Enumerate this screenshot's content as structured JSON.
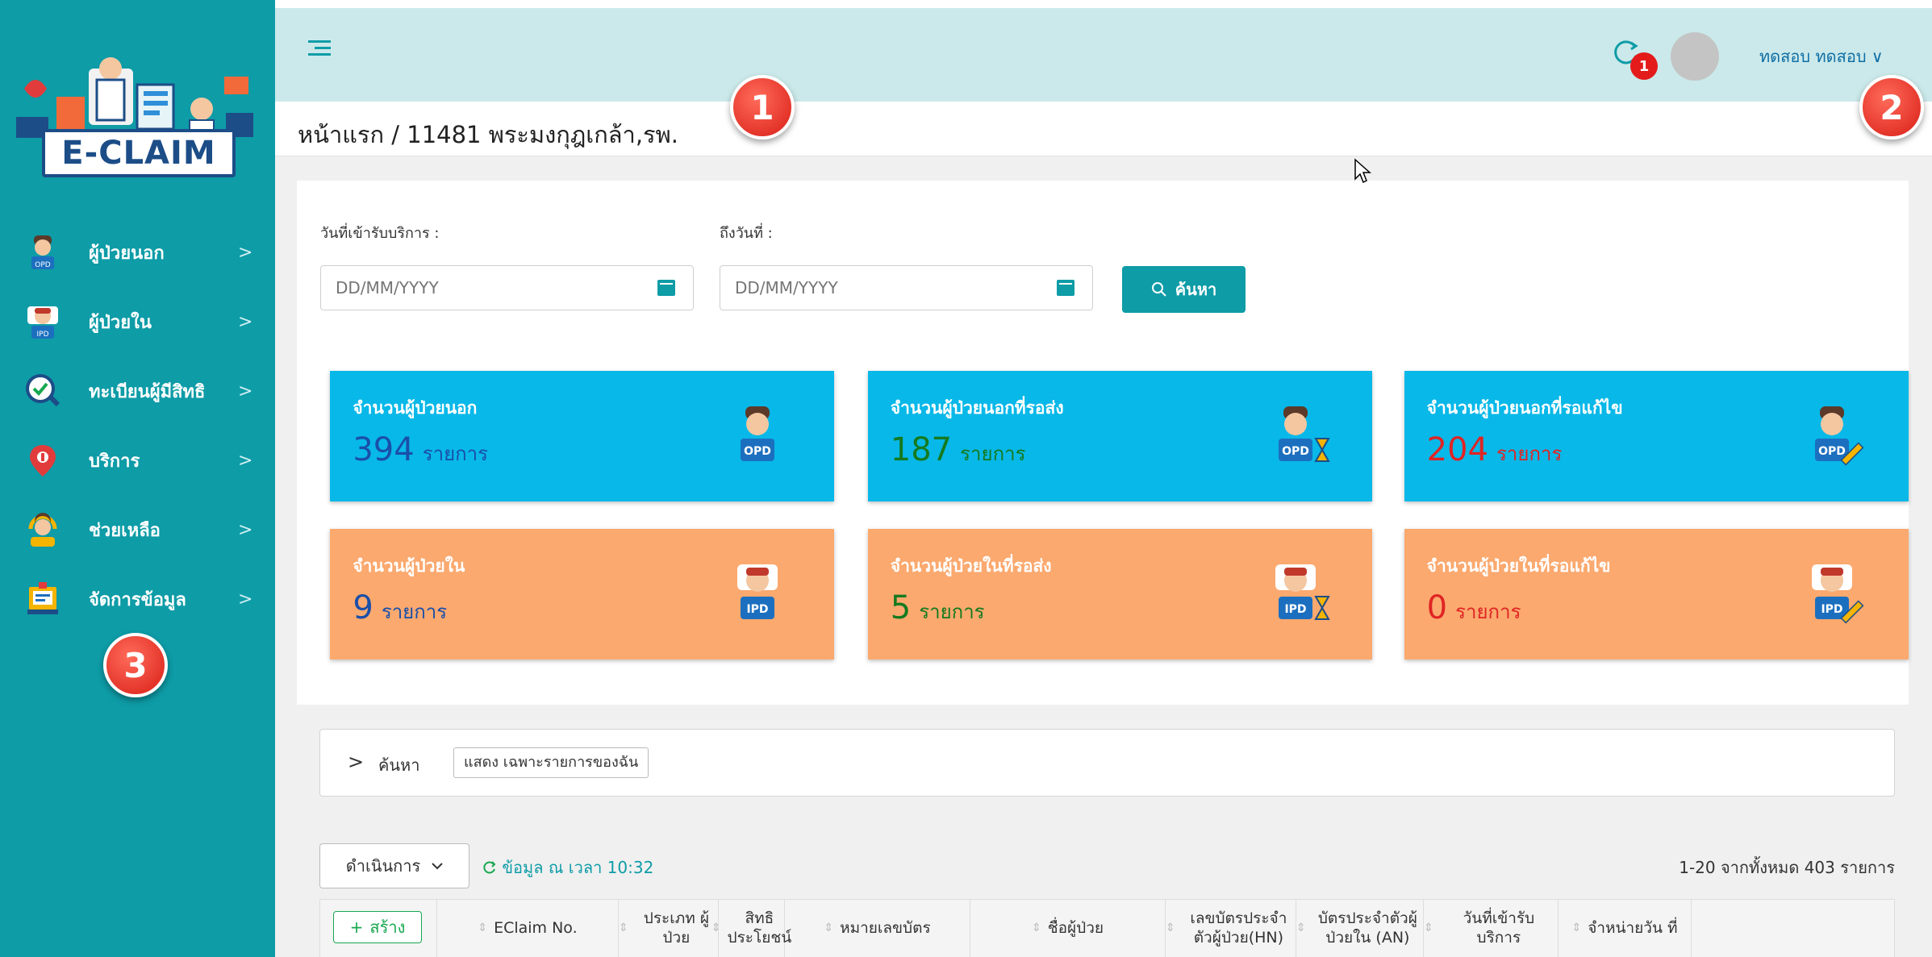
{
  "app": {
    "logo_text": "E-CLAIM"
  },
  "sidebar": {
    "items": [
      {
        "label": "ผู้ป่วยนอก",
        "icon": "opd-patient-icon"
      },
      {
        "label": "ผู้ป่วยใน",
        "icon": "ipd-patient-icon"
      },
      {
        "label": "ทะเบียนผู้มีสิทธิ",
        "icon": "registry-check-icon"
      },
      {
        "label": "บริการ",
        "icon": "location-pin-icon"
      },
      {
        "label": "ช่วยเหลือ",
        "icon": "support-agent-icon"
      },
      {
        "label": "จัดการข้อมูล",
        "icon": "data-manage-icon"
      }
    ],
    "chevron": ">"
  },
  "header": {
    "notification_count": "1",
    "user_name": "ทดสอบ ทดสอบ",
    "user_chevron": "∨"
  },
  "breadcrumb": {
    "text": "หน้าแรก / 11481 พระมงกุฎเกล้า,รพ."
  },
  "annotations": [
    "1",
    "2",
    "3"
  ],
  "filters": {
    "start_label": "วันที่เข้ารับบริการ :",
    "end_label": "ถึงวันที่ :",
    "start_placeholder": "DD/MM/YYYY",
    "end_placeholder": "DD/MM/YYYY",
    "search_label": "ค้นหา"
  },
  "cards": [
    {
      "title": "จำนวนผู้ป่วยนอก",
      "value": "394",
      "unit": "รายการ",
      "value_color": "#1a4fa8",
      "bg": "blue",
      "icon": "opd-patient-icon"
    },
    {
      "title": "จำนวนผู้ป่วยนอกที่รอส่ง",
      "value": "187",
      "unit": "รายการ",
      "value_color": "#157a1f",
      "bg": "blue",
      "icon": "opd-hourglass-icon"
    },
    {
      "title": "จำนวนผู้ป่วยนอกที่รอแก้ไข",
      "value": "204",
      "unit": "รายการ",
      "value_color": "#e02424",
      "bg": "blue",
      "icon": "opd-edit-icon"
    },
    {
      "title": "จำนวนผู้ป่วยใน",
      "value": "9",
      "unit": "รายการ",
      "value_color": "#1a4fa8",
      "bg": "orange",
      "icon": "ipd-patient-icon"
    },
    {
      "title": "จำนวนผู้ป่วยในที่รอส่ง",
      "value": "5",
      "unit": "รายการ",
      "value_color": "#157a1f",
      "bg": "orange",
      "icon": "ipd-hourglass-icon"
    },
    {
      "title": "จำนวนผู้ป่วยในที่รอแก้ไข",
      "value": "0",
      "unit": "รายการ",
      "value_color": "#e02424",
      "bg": "orange",
      "icon": "ipd-edit-icon"
    }
  ],
  "search_panel": {
    "chevron": ">",
    "label": "ค้นหา",
    "tag": "แสดง เฉพาะรายการของฉัน"
  },
  "toolbar": {
    "action_label": "ดำเนินการ",
    "refresh_text": "ข้อมูล ณ เวลา 10:32",
    "page_info": "1-20 จากทั้งหมด 403 รายการ"
  },
  "table": {
    "create_label": "สร้าง",
    "columns": [
      "EClaim No.",
      "ประเภท ผู้ป่วย",
      "สิทธิ ประโยชน์",
      "หมายเลขบัตร",
      "ชื่อผู้ป่วย",
      "เลขบัตรประจำ ตัวผู้ป่วย(HN)",
      "บัตรประจำตัวผู้ ป่วยใน (AN)",
      "วันที่เข้ารับ บริการ",
      "จำหน่ายวัน ที่"
    ]
  },
  "colors": {
    "sidebar": "#0e9ca7",
    "header": "#cbe9ea",
    "card_blue": "#08b8e8",
    "card_orange": "#fba96f",
    "accent": "#0e9ca7"
  }
}
